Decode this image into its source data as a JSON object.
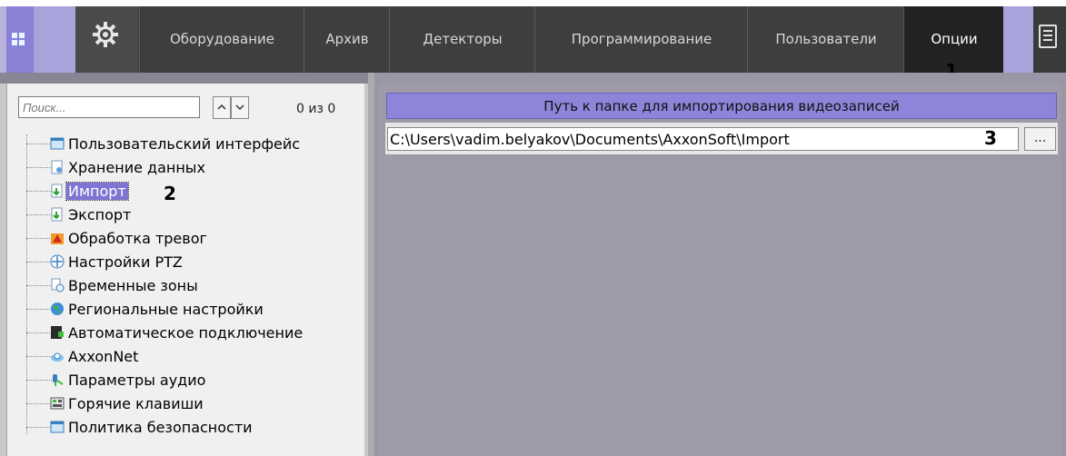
{
  "menu": {
    "items": [
      {
        "label": "Оборудование"
      },
      {
        "label": "Архив"
      },
      {
        "label": "Детекторы"
      },
      {
        "label": "Программирование"
      },
      {
        "label": "Пользователи"
      },
      {
        "label": "Опции",
        "active": true
      }
    ],
    "marker_1": "1"
  },
  "left": {
    "search": {
      "placeholder": "Поиск..."
    },
    "counter": "0 из 0",
    "tree": [
      {
        "label": "Пользовательский интерфейс",
        "icon": "ui-window-icon"
      },
      {
        "label": "Хранение данных",
        "icon": "storage-icon"
      },
      {
        "label": "Импорт",
        "icon": "import-icon",
        "selected": true
      },
      {
        "label": "Экспорт",
        "icon": "export-icon"
      },
      {
        "label": "Обработка тревог",
        "icon": "alarm-icon"
      },
      {
        "label": "Настройки PTZ",
        "icon": "ptz-icon"
      },
      {
        "label": "Временные зоны",
        "icon": "time-zones-icon"
      },
      {
        "label": "Региональные настройки",
        "icon": "globe-icon"
      },
      {
        "label": "Автоматическое подключение",
        "icon": "auto-connect-icon"
      },
      {
        "label": "AxxonNet",
        "icon": "cloud-icon"
      },
      {
        "label": "Параметры аудио",
        "icon": "audio-icon"
      },
      {
        "label": "Горячие клавиши",
        "icon": "hotkeys-icon"
      },
      {
        "label": "Политика безопасности",
        "icon": "security-policy-icon"
      }
    ],
    "marker_2": "2"
  },
  "right": {
    "header": "Путь к папке для импортирования видеозаписей",
    "path_value": "C:\\Users\\vadim.belyakov\\Documents\\AxxonSoft\\Import",
    "browse_label": "...",
    "marker_3": "3"
  },
  "colors": {
    "accent": "#8d85d9",
    "menubar": "#3e3e3e",
    "active_tab": "#222222",
    "selection": "#7e75d2"
  }
}
